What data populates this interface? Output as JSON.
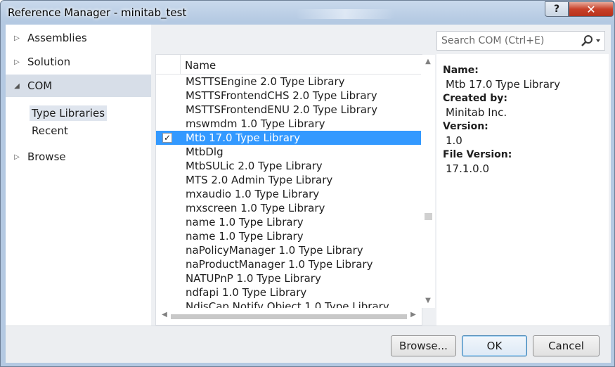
{
  "window": {
    "title": "Reference Manager - minitab_test",
    "help_glyph": "?",
    "close_glyph": "✕"
  },
  "nav": {
    "items": [
      {
        "label": "Assemblies",
        "arrow": "▷"
      },
      {
        "label": "Solution",
        "arrow": "▷"
      },
      {
        "label": "COM",
        "arrow": "◢"
      },
      {
        "label": "Browse",
        "arrow": "▷"
      }
    ],
    "com_children": [
      "Type Libraries",
      "Recent"
    ],
    "selected_child": "Type Libraries"
  },
  "search": {
    "placeholder": "Search COM (Ctrl+E)"
  },
  "list": {
    "column_header": "Name",
    "rows": [
      {
        "name": "MSTTSEngine 2.0 Type Library",
        "checked": false
      },
      {
        "name": "MSTTSFrontendCHS 2.0 Type Library",
        "checked": false
      },
      {
        "name": "MSTTSFrontendENU 2.0 Type Library",
        "checked": false
      },
      {
        "name": "mswmdm 1.0 Type Library",
        "checked": false
      },
      {
        "name": "Mtb 17.0 Type Library",
        "checked": true,
        "selected": true
      },
      {
        "name": "MtbDlg",
        "checked": false
      },
      {
        "name": "MtbSULic 2.0 Type Library",
        "checked": false
      },
      {
        "name": "MTS 2.0 Admin Type Library",
        "checked": false
      },
      {
        "name": "mxaudio 1.0 Type Library",
        "checked": false
      },
      {
        "name": "mxscreen 1.0 Type Library",
        "checked": false
      },
      {
        "name": "name 1.0 Type Library",
        "checked": false
      },
      {
        "name": "name 1.0 Type Library",
        "checked": false
      },
      {
        "name": "naPolicyManager 1.0 Type Library",
        "checked": false
      },
      {
        "name": "naProductManager 1.0 Type Library",
        "checked": false
      },
      {
        "name": "NATUPnP 1.0 Type Library",
        "checked": false
      },
      {
        "name": "ndfapi 1.0 Type Library",
        "checked": false
      },
      {
        "name": "NdisCap Notify Object 1.0 Type Library",
        "checked": false
      }
    ],
    "check_glyph": "✓"
  },
  "details": {
    "name_label": "Name:",
    "name_value": "Mtb 17.0 Type Library",
    "created_label": "Created by:",
    "created_value": "Minitab Inc.",
    "version_label": "Version:",
    "version_value": "1.0",
    "file_version_label": "File Version:",
    "file_version_value": "17.1.0.0"
  },
  "footer": {
    "browse": "Browse...",
    "ok": "OK",
    "cancel": "Cancel"
  },
  "colors": {
    "selection": "#3399ff",
    "nav_selected": "#d7dee8"
  }
}
